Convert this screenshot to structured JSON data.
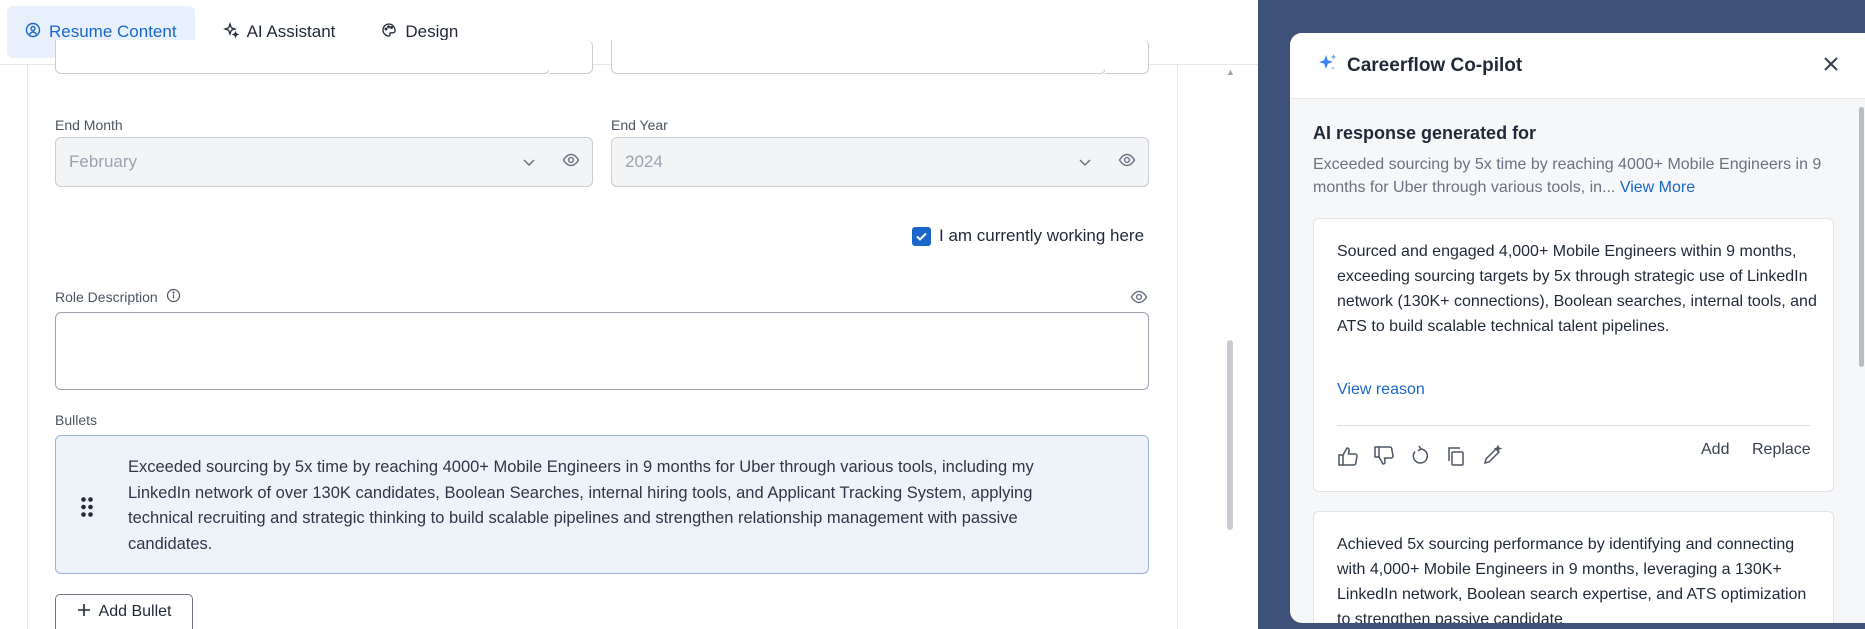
{
  "tabs": [
    {
      "label": "Resume Content",
      "icon": "resume-icon",
      "active": true
    },
    {
      "label": "AI Assistant",
      "icon": "sparkle-icon",
      "active": false
    },
    {
      "label": "Design",
      "icon": "palette-icon",
      "active": false
    }
  ],
  "form": {
    "end_month_label": "End Month",
    "end_month_value": "February",
    "end_year_label": "End Year",
    "end_year_value": "2024",
    "current_label": "I am currently working here",
    "current_checked": true,
    "role_description_label": "Role Description",
    "role_description_value": "",
    "bullets_label": "Bullets",
    "bullets": [
      "Exceeded sourcing by 5x time by reaching 4000+ Mobile Engineers in 9 months for Uber through various tools, including my LinkedIn network of over 130K candidates, Boolean Searches, internal hiring tools, and Applicant Tracking System, applying technical recruiting and strategic thinking to build scalable pipelines and strengthen relationship management with passive candidates."
    ],
    "add_bullet_label": "Add Bullet"
  },
  "copilot": {
    "title": "Careerflow Co-pilot",
    "response_heading": "AI response generated for",
    "response_source": "Exceeded sourcing by 5x time by reaching 4000+ Mobile Engineers in 9 months for Uber through various tools, in...",
    "view_more_label": "View More",
    "suggestions": [
      {
        "text": "Sourced and engaged 4,000+ Mobile Engineers within 9 months, exceeding sourcing targets by 5x through strategic use of LinkedIn network (130K+ connections), Boolean searches, internal tools, and ATS to build scalable technical talent pipelines.",
        "view_reason_label": "View reason",
        "add_label": "Add",
        "replace_label": "Replace"
      },
      {
        "text": "Achieved 5x sourcing performance by identifying and connecting with 4,000+ Mobile Engineers in 9 months, leveraging a 130K+ LinkedIn network, Boolean search expertise, and ATS optimization to strengthen passive candidate"
      }
    ]
  },
  "colors": {
    "accent": "#1a66c9",
    "side_background": "#3d5179"
  }
}
